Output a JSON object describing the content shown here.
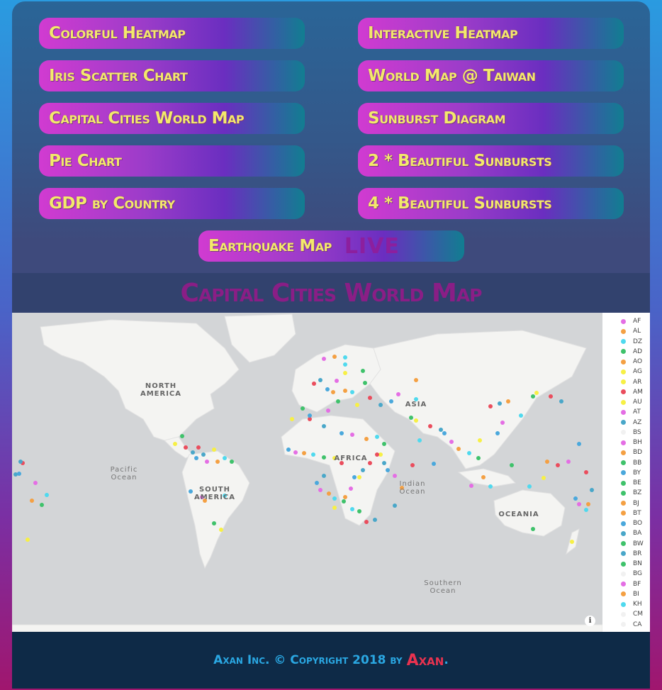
{
  "nav": {
    "left": [
      "Colorful Heatmap",
      "Iris Scatter Chart",
      "Capital Cities World Map",
      "Pie Chart",
      "GDP by Country"
    ],
    "right": [
      "Interactive Heatmap",
      "World Map @ Taiwan",
      "Sunburst Diagram",
      "2 * Beautiful Sunbursts",
      "4 * Beautiful Sunbursts"
    ],
    "center": "Earthquake Map",
    "center_badge": "LIVE"
  },
  "page_title": "Capital Cities World Map",
  "map": {
    "labels": {
      "north_america": "NORTH\nAMERICA",
      "south_america": "SOUTH\nAMERICA",
      "africa": "AFRICA",
      "asia": "ASIA",
      "oceania": "OCEANIA",
      "pacific": "Pacific\nOcean",
      "indian": "Indian\nOcean",
      "southern": "Southern\nOcean"
    },
    "info_icon": "i"
  },
  "legend": [
    {
      "code": "AF",
      "color": "#e46ee4"
    },
    {
      "code": "AL",
      "color": "#f4a043"
    },
    {
      "code": "DZ",
      "color": "#4fd9ee"
    },
    {
      "code": "AD",
      "color": "#3fc26b"
    },
    {
      "code": "AO",
      "color": "#f4a043"
    },
    {
      "code": "AG",
      "color": "#f7f045"
    },
    {
      "code": "AR",
      "color": "#f7f045"
    },
    {
      "code": "AM",
      "color": "#ea4d5d"
    },
    {
      "code": "AU",
      "color": "#f7f045"
    },
    {
      "code": "AT",
      "color": "#e46ee4"
    },
    {
      "code": "AZ",
      "color": "#49a7c9"
    },
    {
      "code": "BS",
      "color": "#f1f1f1"
    },
    {
      "code": "BH",
      "color": "#e46ee4"
    },
    {
      "code": "BD",
      "color": "#f4a043"
    },
    {
      "code": "BB",
      "color": "#3fc26b"
    },
    {
      "code": "BY",
      "color": "#4aa8dc"
    },
    {
      "code": "BE",
      "color": "#3fc26b"
    },
    {
      "code": "BZ",
      "color": "#3fc26b"
    },
    {
      "code": "BJ",
      "color": "#f4a043"
    },
    {
      "code": "BT",
      "color": "#f4a043"
    },
    {
      "code": "BO",
      "color": "#4aa8dc"
    },
    {
      "code": "BA",
      "color": "#49a7c9"
    },
    {
      "code": "BW",
      "color": "#3fc26b"
    },
    {
      "code": "BR",
      "color": "#49a7c9"
    },
    {
      "code": "BN",
      "color": "#3fc26b"
    },
    {
      "code": "BG",
      "color": "#f1f1f1"
    },
    {
      "code": "BF",
      "color": "#e46ee4"
    },
    {
      "code": "BI",
      "color": "#f4a043"
    },
    {
      "code": "KH",
      "color": "#4fd9ee"
    },
    {
      "code": "CM",
      "color": "#f1f1f1"
    },
    {
      "code": "CA",
      "color": "#f1f1f1"
    }
  ],
  "footer": {
    "text": "Axan Inc. © Copyright 2018 by",
    "brand": "Axan",
    "end": "."
  },
  "colors": {
    "accent_yellow": "#f3e96b",
    "title_purple": "#8a1e86",
    "footer_blue": "#2aa7e2",
    "brand_red": "#e8324f"
  }
}
